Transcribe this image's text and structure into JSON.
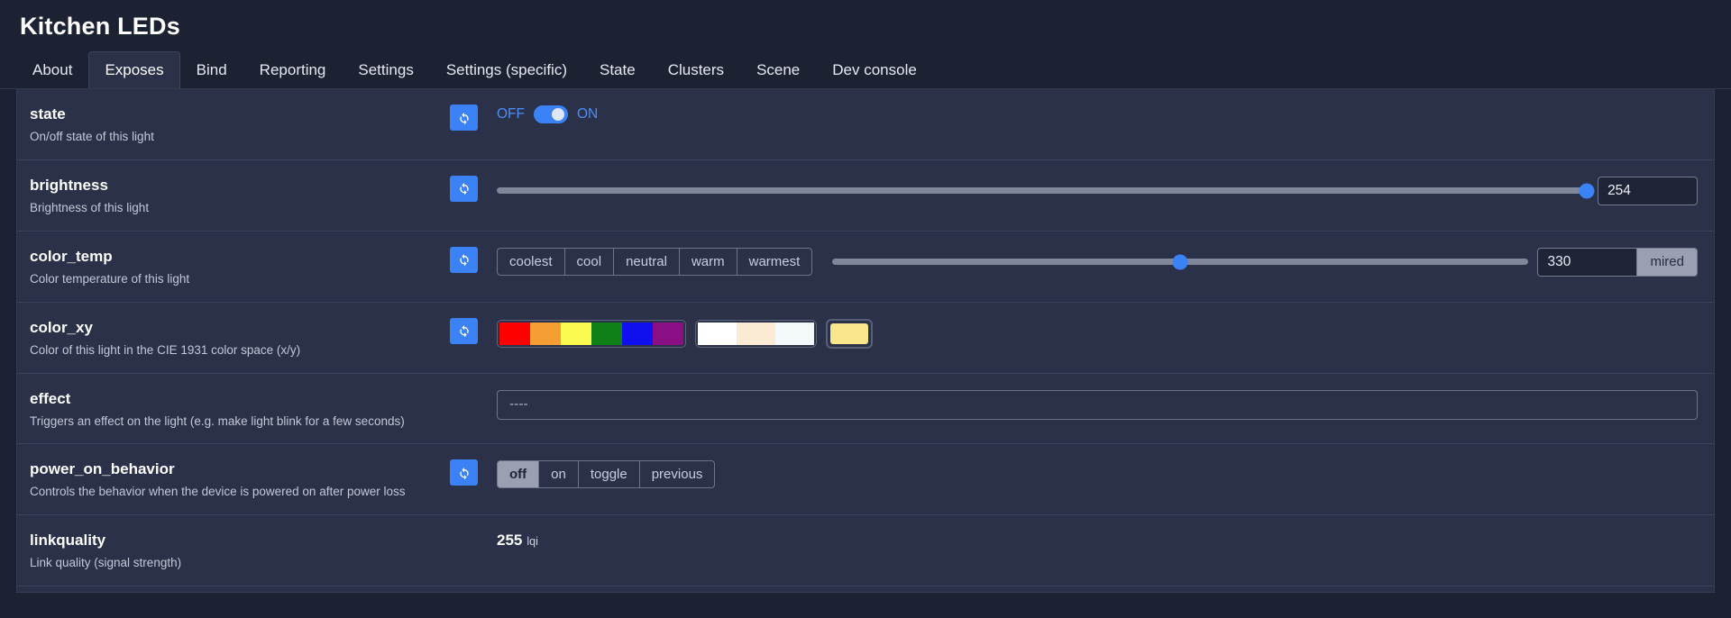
{
  "header": {
    "title": "Kitchen LEDs"
  },
  "tabs": [
    {
      "label": "About",
      "active": false
    },
    {
      "label": "Exposes",
      "active": true
    },
    {
      "label": "Bind",
      "active": false
    },
    {
      "label": "Reporting",
      "active": false
    },
    {
      "label": "Settings",
      "active": false
    },
    {
      "label": "Settings (specific)",
      "active": false
    },
    {
      "label": "State",
      "active": false
    },
    {
      "label": "Clusters",
      "active": false
    },
    {
      "label": "Scene",
      "active": false
    },
    {
      "label": "Dev console",
      "active": false
    }
  ],
  "icons": {
    "refresh": "refresh-icon"
  },
  "colors": {
    "accent": "#3b82f6",
    "card_bg": "#2a3149",
    "page_bg": "#1d2233",
    "divider": "#3a4260"
  },
  "rows": {
    "state": {
      "name": "state",
      "description": "On/off state of this light",
      "refresh": true,
      "off_label": "OFF",
      "on_label": "ON",
      "value": "ON"
    },
    "brightness": {
      "name": "brightness",
      "description": "Brightness of this light",
      "refresh": true,
      "value": "254",
      "min": 0,
      "max": 254,
      "percent": 100
    },
    "color_temp": {
      "name": "color_temp",
      "description": "Color temperature of this light",
      "refresh": true,
      "presets": [
        "coolest",
        "cool",
        "neutral",
        "warm",
        "warmest"
      ],
      "value": "330",
      "unit": "mired",
      "min": 150,
      "max": 500,
      "percent": 50
    },
    "color_xy": {
      "name": "color_xy",
      "description": "Color of this light in the CIE 1931 color space (x/y)",
      "refresh": true,
      "palette": [
        "#FF0000",
        "#F59E34",
        "#FAFA50",
        "#0F8017",
        "#0F0FF0",
        "#8A0F85"
      ],
      "whites": [
        "#FFFFFF",
        "#FCEBD4",
        "#F4FAFC"
      ],
      "current": "#F9E68C"
    },
    "effect": {
      "name": "effect",
      "description": "Triggers an effect on the light (e.g. make light blink for a few seconds)",
      "refresh": false,
      "value": "----"
    },
    "power_on_behavior": {
      "name": "power_on_behavior",
      "description": "Controls the behavior when the device is powered on after power loss",
      "refresh": true,
      "options": [
        "off",
        "on",
        "toggle",
        "previous"
      ],
      "selected": "off"
    },
    "linkquality": {
      "name": "linkquality",
      "description": "Link quality (signal strength)",
      "refresh": false,
      "value": "255",
      "unit": "lqi"
    }
  }
}
